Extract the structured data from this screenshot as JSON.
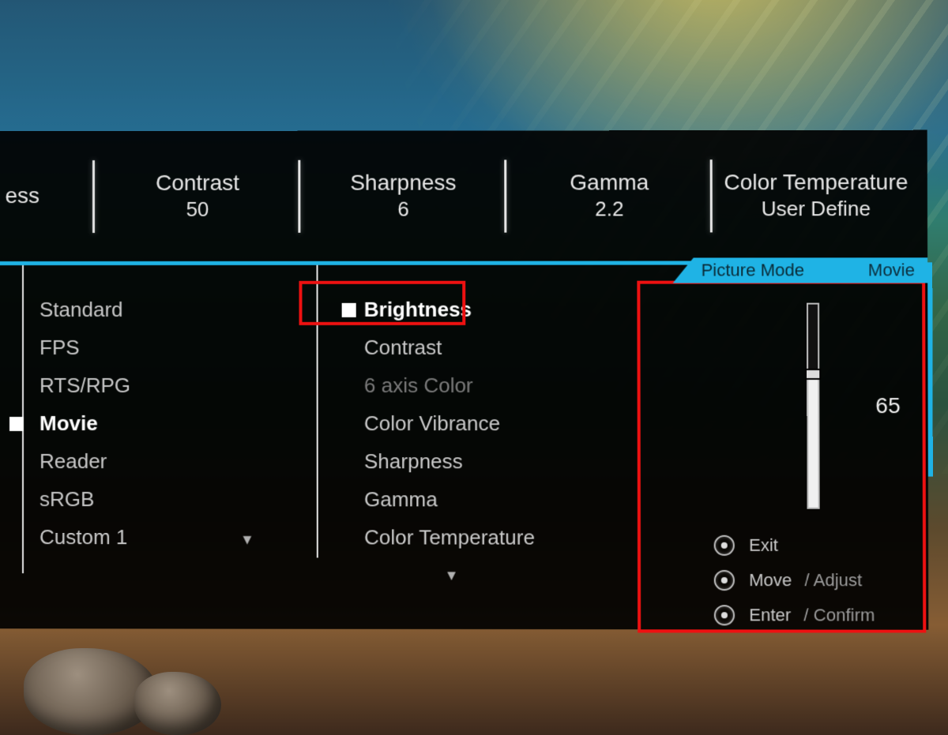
{
  "summary": {
    "items": [
      {
        "label": "ess",
        "value": ""
      },
      {
        "label": "Contrast",
        "value": "50"
      },
      {
        "label": "Sharpness",
        "value": "6"
      },
      {
        "label": "Gamma",
        "value": "2.2"
      },
      {
        "label": "Color Temperature",
        "value": "User Define"
      }
    ]
  },
  "mode_tab": {
    "label": "Picture Mode",
    "value": "Movie"
  },
  "picture_modes": [
    {
      "label": "Standard",
      "selected": false
    },
    {
      "label": "FPS",
      "selected": false
    },
    {
      "label": "RTS/RPG",
      "selected": false
    },
    {
      "label": "Movie",
      "selected": true
    },
    {
      "label": "Reader",
      "selected": false
    },
    {
      "label": "sRGB",
      "selected": false
    },
    {
      "label": "Custom 1",
      "selected": false,
      "more": true
    }
  ],
  "settings": [
    {
      "label": "Brightness",
      "highlighted": true
    },
    {
      "label": "Contrast"
    },
    {
      "label": "6 axis Color",
      "dim": true
    },
    {
      "label": "Color Vibrance"
    },
    {
      "label": "Sharpness"
    },
    {
      "label": "Gamma"
    },
    {
      "label": "Color Temperature",
      "more": true
    }
  ],
  "slider": {
    "value": 65,
    "min": 0,
    "max": 100
  },
  "hints": [
    {
      "action": "Exit",
      "sub": ""
    },
    {
      "action": "Move",
      "sub": "/ Adjust"
    },
    {
      "action": "Enter",
      "sub": "/ Confirm"
    }
  ]
}
